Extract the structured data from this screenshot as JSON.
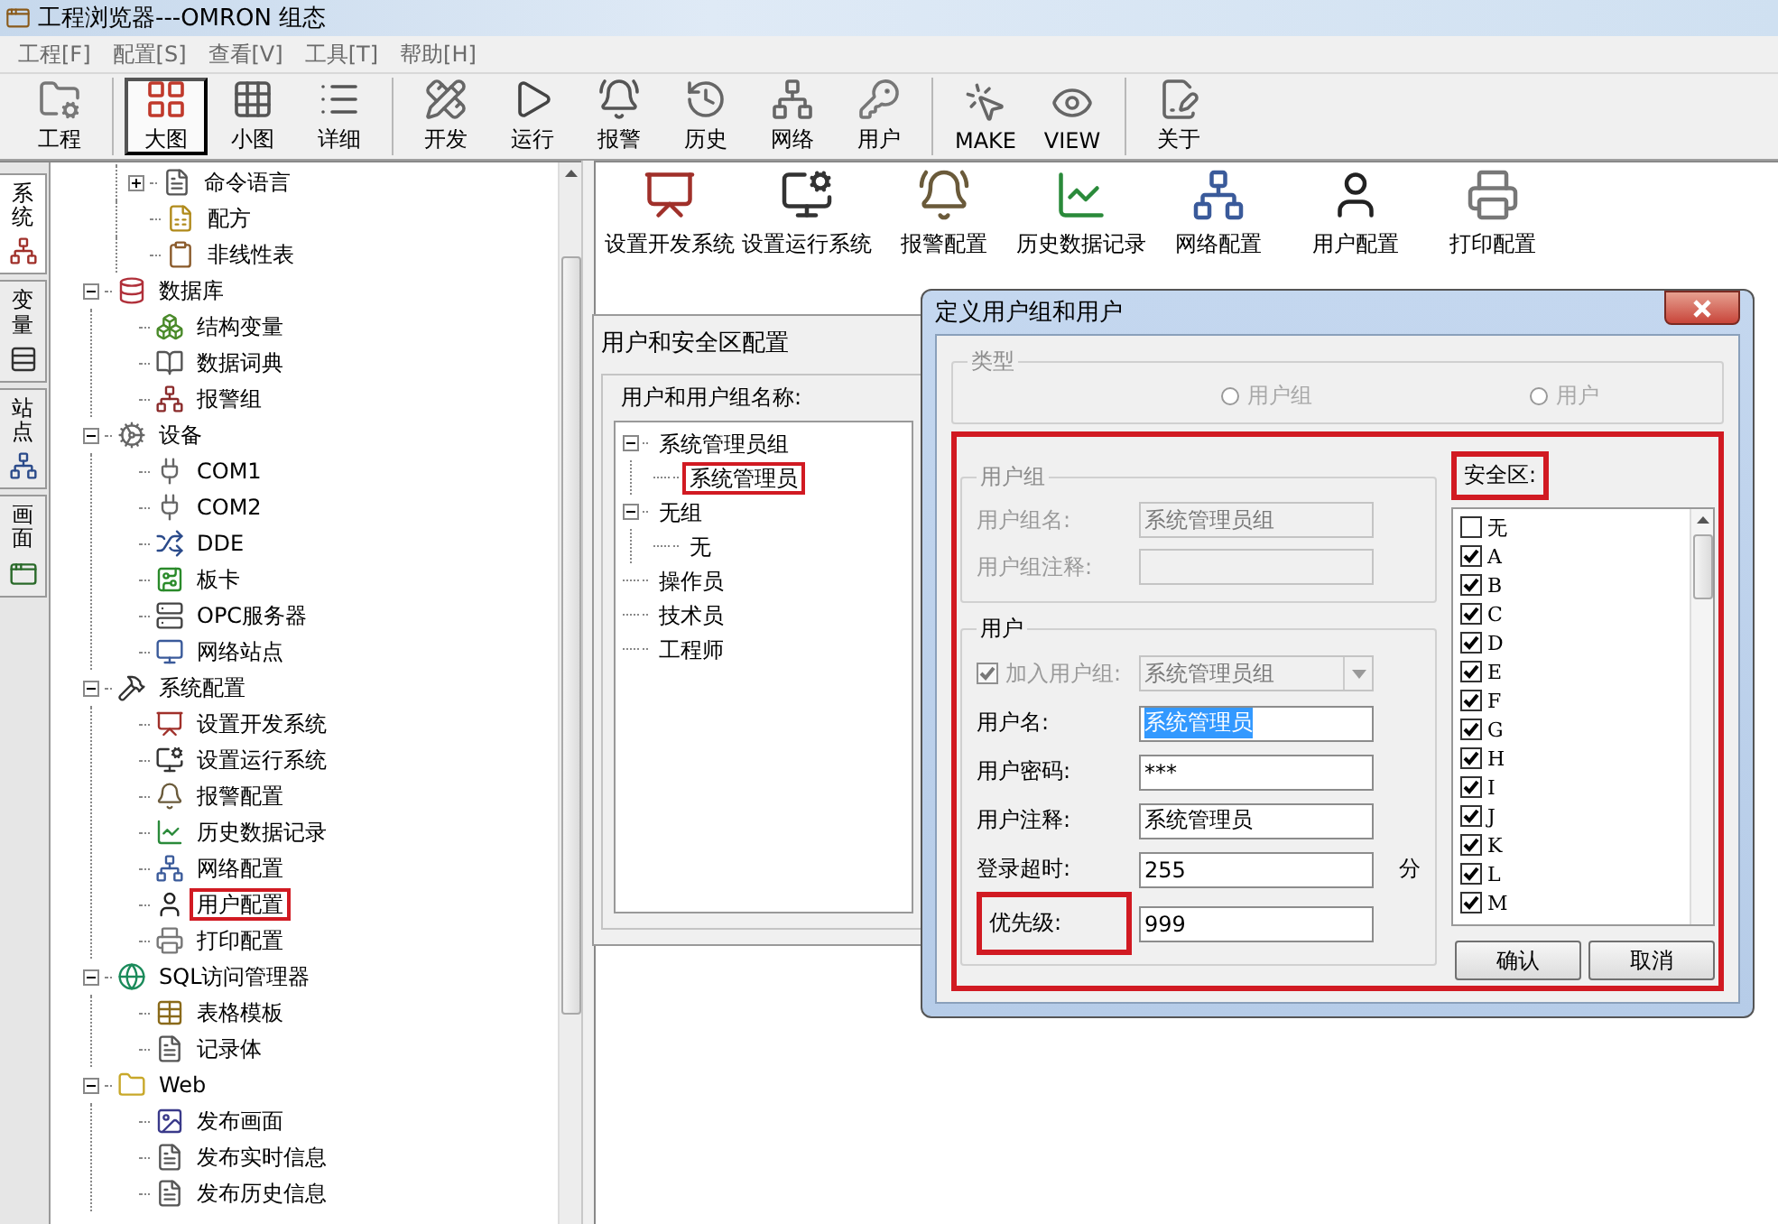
{
  "window": {
    "title": "工程浏览器---OMRON 组态"
  },
  "menu": [
    "工程[F]",
    "配置[S]",
    "查看[V]",
    "工具[T]",
    "帮助[H]"
  ],
  "toolbar": {
    "groups": [
      [
        {
          "label": "工程"
        }
      ],
      [
        {
          "label": "大图",
          "selected": true
        },
        {
          "label": "小图",
          "selected": false
        },
        {
          "label": "详细",
          "selected": false
        }
      ],
      [
        {
          "label": "开发"
        },
        {
          "label": "运行"
        },
        {
          "label": "报警"
        },
        {
          "label": "历史"
        },
        {
          "label": "网络"
        },
        {
          "label": "用户"
        }
      ],
      [
        {
          "label": "MAKE"
        },
        {
          "label": "VIEW"
        }
      ],
      [
        {
          "label": "关于"
        }
      ]
    ]
  },
  "side_tabs": [
    {
      "label": "系统",
      "selected": true
    },
    {
      "label": "变量",
      "selected": false
    },
    {
      "label": "站点",
      "selected": false
    },
    {
      "label": "画面",
      "selected": false
    }
  ],
  "tree": {
    "continued": [
      {
        "label": "命令语言",
        "expanded": false
      },
      {
        "label": "配方"
      },
      {
        "label": "非线性表"
      }
    ],
    "nodes": [
      {
        "label": "数据库",
        "expanded": true,
        "children": [
          {
            "label": "结构变量"
          },
          {
            "label": "数据词典"
          },
          {
            "label": "报警组"
          }
        ]
      },
      {
        "label": "设备",
        "expanded": true,
        "children": [
          {
            "label": "COM1"
          },
          {
            "label": "COM2"
          },
          {
            "label": "DDE"
          },
          {
            "label": "板卡"
          },
          {
            "label": "OPC服务器"
          },
          {
            "label": "网络站点"
          }
        ]
      },
      {
        "label": "系统配置",
        "expanded": true,
        "children": [
          {
            "label": "设置开发系统"
          },
          {
            "label": "设置运行系统"
          },
          {
            "label": "报警配置"
          },
          {
            "label": "历史数据记录"
          },
          {
            "label": "网络配置"
          },
          {
            "label": "用户配置",
            "highlighted": true
          },
          {
            "label": "打印配置"
          }
        ]
      },
      {
        "label": "SQL访问管理器",
        "expanded": true,
        "children": [
          {
            "label": "表格模板"
          },
          {
            "label": "记录体"
          }
        ]
      },
      {
        "label": "Web",
        "expanded": true,
        "children": [
          {
            "label": "发布画面"
          },
          {
            "label": "发布实时信息"
          },
          {
            "label": "发布历史信息"
          }
        ]
      }
    ]
  },
  "config_icons": [
    "设置开发系统",
    "设置运行系统",
    "报警配置",
    "历史数据记录",
    "网络配置",
    "用户配置",
    "打印配置"
  ],
  "user_window": {
    "title": "用户和安全区配置",
    "group_label": "用户和用户组名称:",
    "tree": [
      {
        "label": "系统管理员组",
        "expanded": true,
        "children": [
          {
            "label": "系统管理员",
            "highlighted": true
          }
        ]
      },
      {
        "label": "无组",
        "expanded": true,
        "children": [
          {
            "label": "无"
          }
        ]
      },
      {
        "label": "操作员"
      },
      {
        "label": "技术员"
      },
      {
        "label": "工程师"
      }
    ]
  },
  "dialog": {
    "title": "定义用户组和用户",
    "highlighted": true,
    "type_group": {
      "label": "类型",
      "disabled": true,
      "options": [
        {
          "label": "用户组",
          "selected": false
        },
        {
          "label": "用户",
          "selected": false
        }
      ]
    },
    "group_section": {
      "label": "用户组",
      "disabled": true,
      "fields": [
        {
          "label": "用户组名:",
          "value": "系统管理员组"
        },
        {
          "label": "用户组注释:"
        }
      ]
    },
    "user_section": {
      "label": "用户",
      "join": {
        "label": "加入用户组:",
        "checked": true,
        "disabled": true,
        "value": "系统管理员组"
      },
      "fields": [
        {
          "label": "用户名:",
          "value": "系统管理员",
          "text_selected": true
        },
        {
          "label": "用户密码:",
          "value": "***"
        },
        {
          "label": "用户注释:",
          "value": "系统管理员"
        },
        {
          "label": "登录超时:",
          "value": "255",
          "unit": "分"
        },
        {
          "label": "优先级:",
          "value": "999",
          "highlighted": true
        }
      ]
    },
    "security": {
      "label": "安全区:",
      "highlighted": true,
      "zones": [
        {
          "label": "无",
          "checked": false
        },
        {
          "label": "A",
          "checked": true
        },
        {
          "label": "B",
          "checked": true
        },
        {
          "label": "C",
          "checked": true
        },
        {
          "label": "D",
          "checked": true
        },
        {
          "label": "E",
          "checked": true
        },
        {
          "label": "F",
          "checked": true
        },
        {
          "label": "G",
          "checked": true
        },
        {
          "label": "H",
          "checked": true
        },
        {
          "label": "I",
          "checked": true
        },
        {
          "label": "J",
          "checked": true
        },
        {
          "label": "K",
          "checked": true
        },
        {
          "label": "L",
          "checked": true
        },
        {
          "label": "M",
          "checked": true
        }
      ]
    },
    "buttons": [
      "确认",
      "取消"
    ]
  }
}
